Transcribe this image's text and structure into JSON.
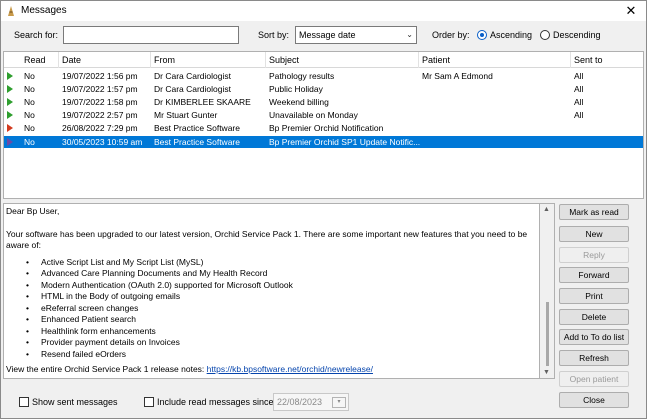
{
  "window": {
    "title": "Messages"
  },
  "toolbar": {
    "search_label": "Search for:",
    "search_value": "",
    "sortby_label": "Sort by:",
    "sortby_value": "Message date",
    "orderby_label": "Order by:",
    "order_ascending": "Ascending",
    "order_descending": "Descending",
    "order_selected": "Ascending"
  },
  "grid": {
    "columns": [
      "Read",
      "Date",
      "From",
      "Subject",
      "Patient",
      "Sent to"
    ],
    "rows": [
      {
        "icon": "green",
        "read": "No",
        "date": "19/07/2022 1:56 pm",
        "from": "Dr Cara Cardiologist",
        "subject": "Pathology results",
        "patient": "Mr Sam A Edmond",
        "sent_to": "All"
      },
      {
        "icon": "green",
        "read": "No",
        "date": "19/07/2022 1:57 pm",
        "from": "Dr Cara Cardiologist",
        "subject": "Public Holiday",
        "patient": "",
        "sent_to": "All"
      },
      {
        "icon": "green",
        "read": "No",
        "date": "19/07/2022 1:58 pm",
        "from": "Dr KIMBERLEE SKAARE",
        "subject": "Weekend billing",
        "patient": "",
        "sent_to": "All"
      },
      {
        "icon": "green",
        "read": "No",
        "date": "19/07/2022 2:57 pm",
        "from": "Mr Stuart Gunter",
        "subject": "Unavailable on Monday",
        "patient": "",
        "sent_to": "All"
      },
      {
        "icon": "red",
        "read": "No",
        "date": "26/08/2022 7:29 pm",
        "from": "Best Practice Software",
        "subject": "Bp Premier Orchid Notification",
        "patient": "",
        "sent_to": ""
      },
      {
        "icon": "purple",
        "read": "No",
        "date": "30/05/2023 10:59 am",
        "from": "Best Practice Software",
        "subject": "Bp Premier Orchid SP1 Update Notific...",
        "patient": "",
        "sent_to": "",
        "selected": true
      }
    ]
  },
  "message": {
    "greeting": "Dear Bp User,",
    "intro": "Your software has been upgraded to our latest version, Orchid Service Pack 1.  There are some important new features that you need to be aware of:",
    "features": [
      "Active Script List and My Script List (MySL)",
      "Advanced Care Planning Documents and My Health Record",
      "Modern Authentication (OAuth 2.0) supported for Microsoft Outlook",
      "HTML in the Body of outgoing emails",
      "eReferral screen changes",
      "Enhanced Patient search",
      "Healthlink form enhancements",
      "Provider payment details on Invoices",
      "Resend failed eOrders"
    ],
    "release_text": "View the entire Orchid Service Pack 1 release notes: ",
    "release_link": "https://kb.bpsoftware.net/orchid/newrelease/"
  },
  "buttons": {
    "mark_as_read": "Mark as read",
    "new": "New",
    "reply": "Reply",
    "forward": "Forward",
    "print": "Print",
    "delete": "Delete",
    "add_to_do": "Add to To do list",
    "refresh": "Refresh",
    "open_patient": "Open patient",
    "close": "Close"
  },
  "footer": {
    "show_sent": "Show sent messages",
    "include_read": "Include read messages since",
    "since_date": "22/08/2023"
  }
}
